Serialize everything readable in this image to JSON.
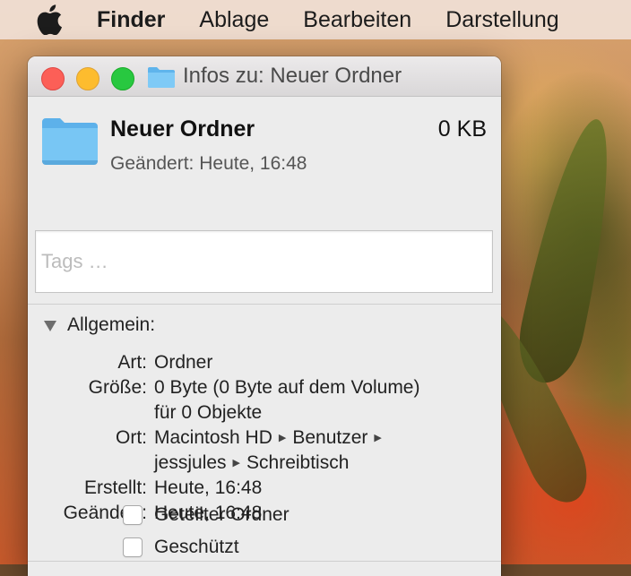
{
  "menubar": {
    "items": [
      {
        "label": "Finder",
        "bold": true
      },
      {
        "label": "Ablage",
        "bold": false
      },
      {
        "label": "Bearbeiten",
        "bold": false
      },
      {
        "label": "Darstellung",
        "bold": false
      }
    ]
  },
  "window": {
    "title": "Infos zu: Neuer Ordner",
    "item_name": "Neuer Ordner",
    "item_size": "0 KB",
    "item_modified": "Geändert: Heute, 16:48",
    "tags_placeholder": "Tags …",
    "section_title": "Allgemein:",
    "info": {
      "kind_label": "Art:",
      "kind_value": "Ordner",
      "size_label": "Größe:",
      "size_value": "0 Byte (0 Byte auf dem Volume)",
      "size_value_2": "für 0 Objekte",
      "location_label": "Ort:",
      "location_parts": [
        "Macintosh HD",
        "Benutzer",
        "jessjules",
        "Schreibtisch"
      ],
      "created_label": "Erstellt:",
      "created_value": "Heute, 16:48",
      "modified_label": "Geändert:",
      "modified_value": "Heute, 16:48"
    },
    "checkboxes": {
      "shared_label": "Geteilter Ordner",
      "shared_checked": false,
      "locked_label": "Geschützt",
      "locked_checked": false
    }
  },
  "colors": {
    "close": "#fc5f57",
    "minimize": "#fdbc2e",
    "zoom": "#28c840",
    "folder": "#6cc2f4"
  }
}
